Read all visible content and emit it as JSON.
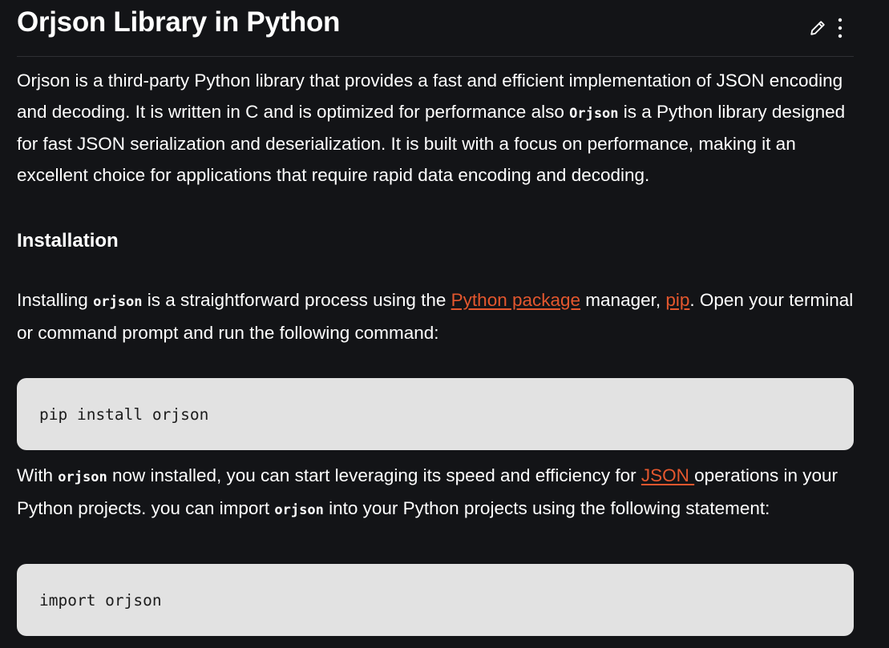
{
  "article": {
    "title": "Orjson Library in Python"
  },
  "toolbar": {
    "edit_icon": "pencil-icon",
    "more_icon": "vertical-dots-icon"
  },
  "intro": {
    "text": "Orjson is a third-party Python library that provides a fast and efficient implementation of JSON encoding and decoding. It is written in C and is optimized for performance also ",
    "code": "Orjson",
    "text_after": " is a Python library designed for fast JSON serialization and deserialization. It is built with a focus on performance, making it an excellent choice for applications that require rapid data encoding and decoding."
  },
  "installation": {
    "heading": "Installation",
    "p1_part1": "Installing ",
    "p1_code": "orjson",
    "p1_part2": " is a straightforward process using the ",
    "p1_link1": "Python package",
    "p1_part3": " manager, ",
    "p1_link2": "pip",
    "p1_part4": ". Open your terminal or command prompt and run the following command:",
    "code1": "pip install orjson",
    "p2_part1": "With ",
    "p2_code1": "orjson",
    "p2_part2": " now installed, you can start leveraging its speed and efficiency for ",
    "p2_link": "JSON ",
    "p2_part3": "operations in your Python projects. you can import ",
    "p2_code2": "orjson",
    "p2_part4": " into your Python projects using the following statement:",
    "code2": "import orjson"
  },
  "colors": {
    "background": "#131417",
    "text": "#ffffff",
    "link": "#e4572e",
    "code_block_bg": "#e2e2e2",
    "code_block_text": "#1c1c1c",
    "divider": "#2e3034"
  }
}
